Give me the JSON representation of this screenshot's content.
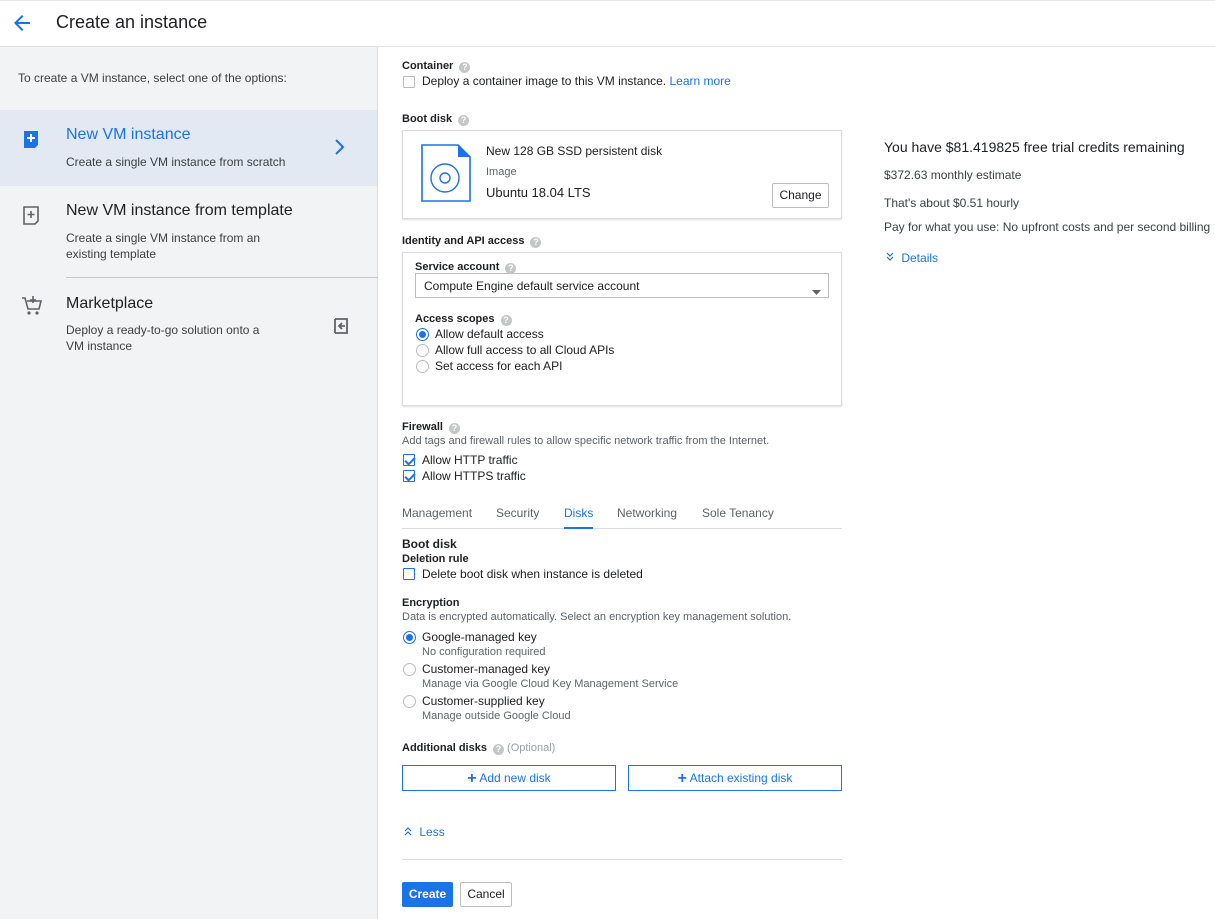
{
  "header": {
    "title": "Create an instance"
  },
  "sidebar": {
    "intro": "To create a VM instance, select one of the options:",
    "options": [
      {
        "title": "New VM instance",
        "desc": "Create a single VM instance from scratch"
      },
      {
        "title": "New VM instance from template",
        "desc": "Create a single VM instance from an existing template"
      },
      {
        "title": "Marketplace",
        "desc": "Deploy a ready-to-go solution onto a VM instance"
      }
    ]
  },
  "container": {
    "label": "Container",
    "checkbox_label": "Deploy a container image to this VM instance.",
    "learn_more": "Learn more"
  },
  "boot_disk": {
    "label": "Boot disk",
    "disk_name": "New 128 GB SSD persistent disk",
    "image_label": "Image",
    "image_value": "Ubuntu 18.04 LTS",
    "change_button": "Change"
  },
  "identity": {
    "label": "Identity and API access",
    "service_account_label": "Service account",
    "service_account_value": "Compute Engine default service account",
    "access_scopes_label": "Access scopes",
    "scopes": [
      "Allow default access",
      "Allow full access to all Cloud APIs",
      "Set access for each API"
    ]
  },
  "firewall": {
    "label": "Firewall",
    "desc": "Add tags and firewall rules to allow specific network traffic from the Internet.",
    "options": [
      "Allow HTTP traffic",
      "Allow HTTPS traffic"
    ]
  },
  "tabs": [
    "Management",
    "Security",
    "Disks",
    "Networking",
    "Sole Tenancy"
  ],
  "disks": {
    "boot_disk_heading": "Boot disk",
    "deletion_rule_label": "Deletion rule",
    "deletion_rule_checkbox": "Delete boot disk when instance is deleted",
    "encryption_label": "Encryption",
    "encryption_desc": "Data is encrypted automatically. Select an encryption key management solution.",
    "encryption_options": [
      {
        "label": "Google-managed key",
        "sub": "No configuration required"
      },
      {
        "label": "Customer-managed key",
        "sub": "Manage via Google Cloud Key Management Service"
      },
      {
        "label": "Customer-supplied key",
        "sub": "Manage outside Google Cloud"
      }
    ],
    "additional_disks_label": "Additional disks",
    "optional": "(Optional)",
    "add_new_disk": "Add new disk",
    "attach_existing_disk": "Attach existing disk"
  },
  "less_link": "Less",
  "actions": {
    "create": "Create",
    "cancel": "Cancel"
  },
  "pricing": {
    "credits": "You have $81.419825 free trial credits remaining",
    "monthly": "$372.63 monthly estimate",
    "hourly": "That's about $0.51 hourly",
    "pay": "Pay for what you use: No upfront costs and per second billing",
    "details": "Details"
  },
  "colors": {
    "accent": "#1a73e8",
    "sidebar_bg": "#f1f3f4",
    "active_bg": "#e2e9f3"
  }
}
